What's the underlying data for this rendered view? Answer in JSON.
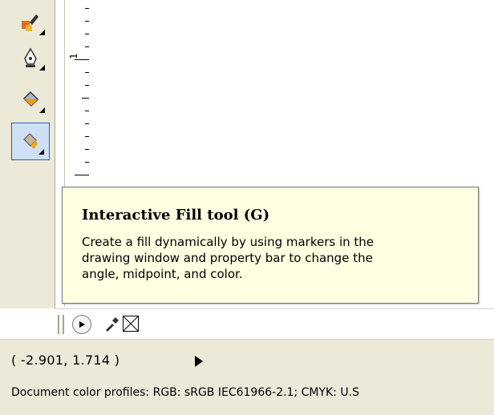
{
  "toolbox": {
    "tools": [
      {
        "name": "eyedropper-tool",
        "icon": "eyedropper-icon"
      },
      {
        "name": "outline-pen-tool",
        "icon": "pen-nib-icon"
      },
      {
        "name": "fill-tool",
        "icon": "paint-bucket-icon"
      },
      {
        "name": "interactive-fill-tool",
        "icon": "interactive-fill-icon",
        "selected": true
      }
    ]
  },
  "ruler": {
    "label": "1"
  },
  "tooltip": {
    "title": "Interactive Fill tool (G)",
    "lines": [
      "Create a fill dynamically by using markers in the",
      "drawing window and property bar to change the",
      "angle, midpoint, and color."
    ]
  },
  "palette": {
    "items": [
      "palette-grip",
      "scroll-right-icon",
      "eyedropper-icon",
      "no-color-swatch"
    ]
  },
  "status": {
    "coords": "( -2.901, 1.714 )",
    "profiles": "Document color profiles: RGB: sRGB IEC61966-2.1; CMYK: U.S"
  },
  "colors": {
    "tooltip_bg": "#ffffe1",
    "selected_tool_bg": "#cfe0f4",
    "selected_tool_border": "#2c5db8",
    "chrome_bg": "#ece9d8"
  }
}
